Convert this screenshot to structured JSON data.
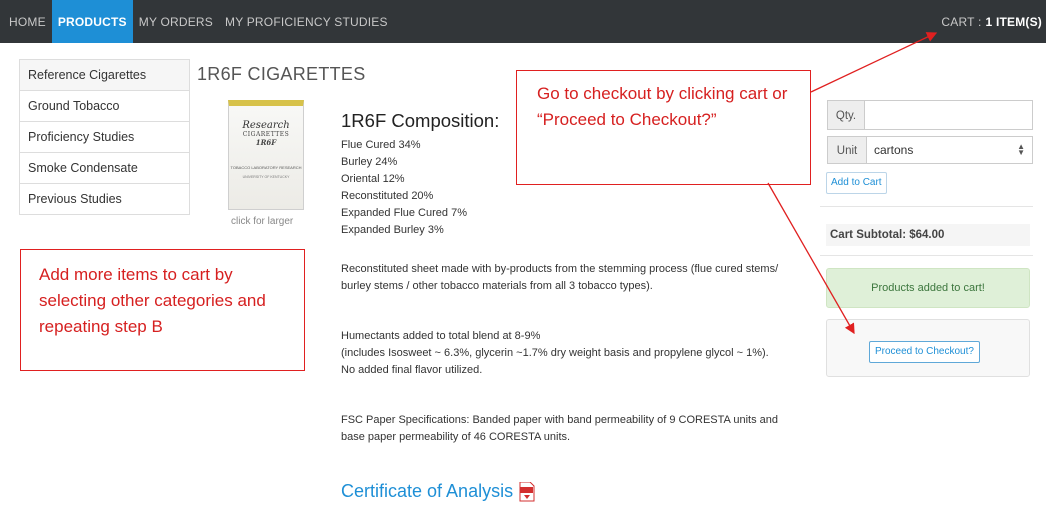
{
  "nav": {
    "items": [
      {
        "label": "HOME",
        "active": false
      },
      {
        "label": "PRODUCTS",
        "active": true
      },
      {
        "label": "MY ORDERS",
        "active": false
      },
      {
        "label": "MY PROFICIENCY STUDIES",
        "active": false
      }
    ],
    "cart_label": "CART :",
    "cart_count": "1 ITEM(S)"
  },
  "sidebar": {
    "items": [
      {
        "label": "Reference Cigarettes"
      },
      {
        "label": "Ground Tobacco"
      },
      {
        "label": "Proficiency Studies"
      },
      {
        "label": "Smoke Condensate"
      },
      {
        "label": "Previous Studies"
      }
    ]
  },
  "page_title": "1R6F CIGARETTES",
  "product_image": {
    "line1": "Research",
    "line2": "CIGARETTES",
    "line3": "1R6F",
    "line4": "TOBACCO LABORATORY RESEARCH",
    "line5": "UNIVERSITY OF KENTUCKY",
    "caption": "click for larger"
  },
  "composition": {
    "title": "1R6F Composition:",
    "items": [
      "Flue Cured 34%",
      "Burley 24%",
      "Oriental 12%",
      "Reconstituted 20%",
      "Expanded Flue Cured 7%",
      "Expanded Burley 3%"
    ]
  },
  "paragraphs": {
    "reconstituted": "Reconstituted sheet made with by-products from the stemming process (flue cured stems/ burley stems / other tobacco materials from all 3 tobacco types).",
    "humectants_1": "Humectants added to total blend at 8-9%",
    "humectants_2": "(includes Isosweet ~ 6.3%, glycerin ~1.7% dry weight basis and propylene glycol ~ 1%).",
    "humectants_3": "No added final flavor utilized.",
    "fsc": "FSC Paper Specifications: Banded paper with band permeability of 9 CORESTA units and base paper permeability of 46 CORESTA units."
  },
  "certificate_label": "Certificate of Analysis",
  "cart_panel": {
    "qty_label": "Qty.",
    "qty_value": "",
    "unit_label": "Unit",
    "unit_selected": "cartons",
    "add_button": "Add to Cart",
    "subtotal": "Cart Subtotal: $64.00",
    "success_message": "Products added to cart!",
    "checkout_button": "Proceed to Checkout?"
  },
  "annotations": {
    "checkout_note": "Go to checkout by clicking cart or “Proceed to Checkout?”",
    "add_more_note": "Add more items to cart by selecting other categories and repeating step B"
  },
  "colors": {
    "nav_bg": "#323639",
    "accent": "#1e8fd6",
    "annotation": "#e02020",
    "success_bg": "#dff0d8"
  }
}
